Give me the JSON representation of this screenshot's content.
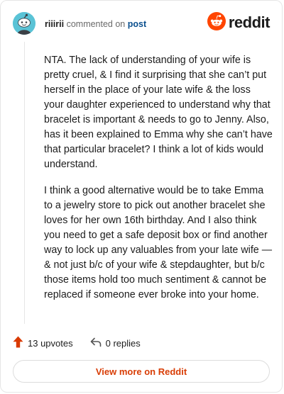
{
  "header": {
    "username": "riiirii",
    "commented_on": "commented on",
    "post_link": "post",
    "brand_name": "reddit",
    "avatar_icon": "snoo-avatar-icon",
    "brand_icon": "reddit-logo-icon"
  },
  "comment": {
    "paragraphs": [
      "NTA. The lack of understanding of your wife is pretty cruel, & I find it surprising that she can’t put herself in the place of your late wife & the loss your daughter experienced to understand why that bracelet is important & needs to go to Jenny. Also, has it been explained to Emma why she can’t have that particular bracelet? I think a lot of kids would understand.",
      "I think a good alternative would be to take Emma to a jewelry store to pick out another bracelet she loves for her own 16th birthday. And I also think you need to get a safe deposit box or find another way to lock up any valuables from your late wife — & not just b/c of your wife & stepdaughter, but b/c those items hold too much sentiment & cannot be replaced if someone ever broke into your home."
    ]
  },
  "actions": {
    "upvotes_label": "13 upvotes",
    "replies_label": "0 replies",
    "upvote_icon": "upvote-arrow-icon",
    "reply_icon": "reply-arrow-icon"
  },
  "footer": {
    "view_more_label": "View more on Reddit"
  },
  "colors": {
    "brand_orange": "#ff4500",
    "upvote_orange": "#d93a00",
    "link_text_orange": "#d83d06",
    "avatar_teal": "#5ac3d6",
    "post_link_blue": "#0a4f8e"
  }
}
